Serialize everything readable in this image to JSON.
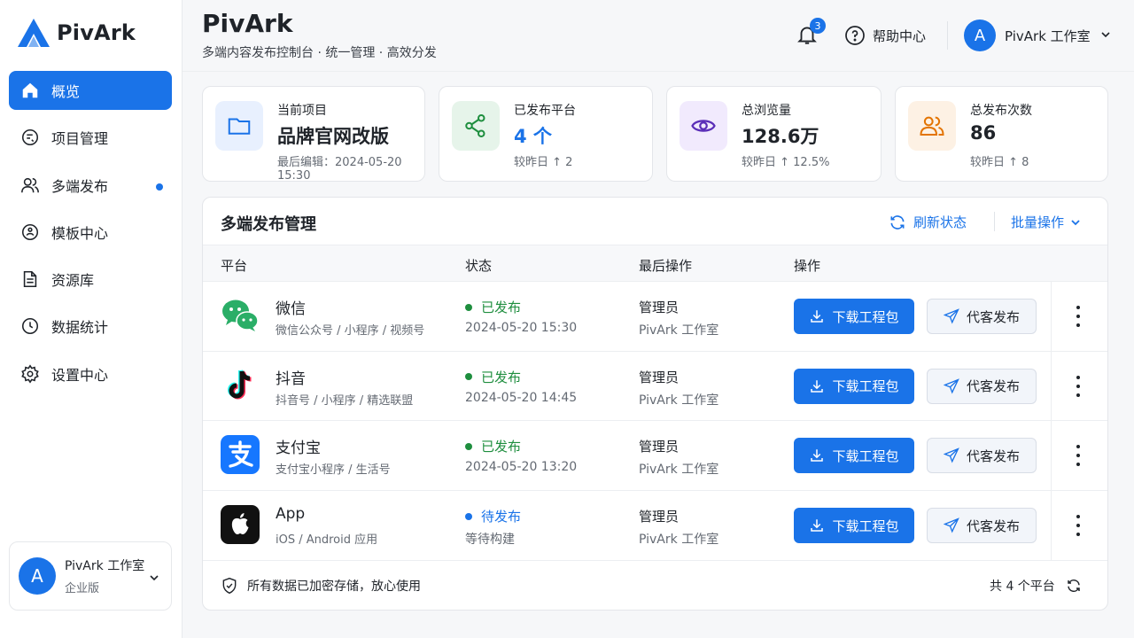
{
  "app": {
    "name": "PivArk"
  },
  "header": {
    "title": "PivArk",
    "subtitle": "多端内容发布控制台 · 统一管理 · 高效分发",
    "notifications": "3",
    "help_label": "帮助中心",
    "user_initial": "A",
    "user_name": "PivArk 工作室"
  },
  "sidebar": {
    "items": [
      {
        "label": "概览",
        "icon": "home-icon",
        "active": true
      },
      {
        "label": "项目管理",
        "icon": "project-icon"
      },
      {
        "label": "多端发布",
        "icon": "users-icon",
        "dot": true
      },
      {
        "label": "模板中心",
        "icon": "template-icon"
      },
      {
        "label": "资源库",
        "icon": "document-icon"
      },
      {
        "label": "数据统计",
        "icon": "clock-icon"
      },
      {
        "label": "设置中心",
        "icon": "gear-icon"
      }
    ],
    "user": {
      "initial": "A",
      "name": "PivArk 工作室",
      "role": "企业版"
    }
  },
  "stats": [
    {
      "label": "当前项目",
      "value": "品牌官网改版",
      "meta": "最后编辑：2024-05-20 15:30",
      "icon": "folder-icon",
      "color": "#1a73e8"
    },
    {
      "label": "已发布平台",
      "value": "4 个",
      "meta": "较昨日 ↑ 2",
      "icon": "share-icon",
      "color": "#1e8e3e"
    },
    {
      "label": "总浏览量",
      "value": "128.6万",
      "meta": "较昨日 ↑ 12.5%",
      "icon": "eye-icon",
      "color": "#5b2fb8"
    },
    {
      "label": "总发布次数",
      "value": "86",
      "meta": "较昨日 ↑ 8",
      "icon": "users-icon",
      "color": "#e37400"
    }
  ],
  "panel": {
    "title": "多端发布管理",
    "refresh_label": "刷新状态",
    "batch_label": "批量操作",
    "columns": [
      "平台",
      "状态",
      "最后操作",
      "操作"
    ],
    "rows": [
      {
        "name": "微信",
        "desc": "微信公众号 / 小程序 / 视频号",
        "status": "已发布",
        "status_type": "ok",
        "time": "2024-05-20 15:30",
        "operator": "管理员",
        "org": "PivArk 工作室",
        "icon": "wechat-icon"
      },
      {
        "name": "抖音",
        "desc": "抖音号 / 小程序 / 精选联盟",
        "status": "已发布",
        "status_type": "ok",
        "time": "2024-05-20 14:45",
        "operator": "管理员",
        "org": "PivArk 工作室",
        "icon": "tiktok-icon"
      },
      {
        "name": "支付宝",
        "desc": "支付宝小程序 / 生活号",
        "status": "已发布",
        "status_type": "ok",
        "time": "2024-05-20 13:20",
        "operator": "管理员",
        "org": "PivArk 工作室",
        "icon": "alipay-icon"
      },
      {
        "name": "App",
        "desc": "iOS / Android 应用",
        "status": "待发布",
        "status_type": "wait",
        "time": "等待构建",
        "operator": "管理员",
        "org": "PivArk 工作室",
        "icon": "apple-icon"
      }
    ],
    "download_label": "下载工程包",
    "publish_label": "代客发布",
    "footer_note": "所有数据已加密存储，放心使用",
    "footer_count": "共 4 个平台"
  }
}
